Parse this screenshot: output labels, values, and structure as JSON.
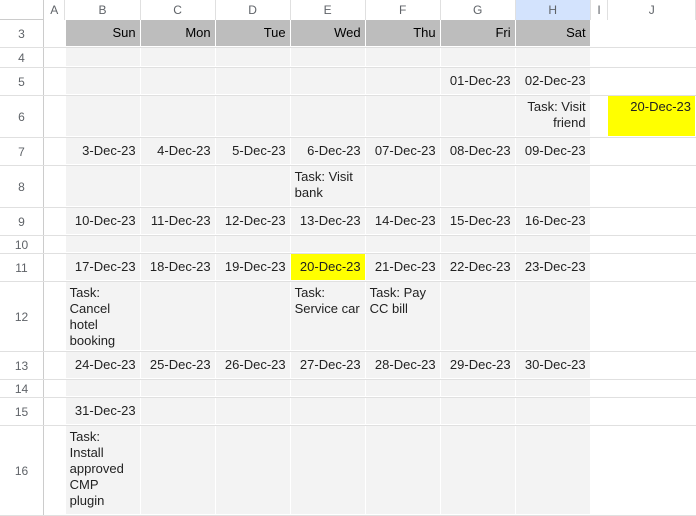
{
  "cols": {
    "A": "A",
    "B": "B",
    "C": "C",
    "D": "D",
    "E": "E",
    "F": "F",
    "G": "G",
    "H": "H",
    "I": "I",
    "J": "J"
  },
  "rows": {
    "3": "3",
    "4": "4",
    "5": "5",
    "6": "6",
    "7": "7",
    "8": "8",
    "9": "9",
    "10": "10",
    "11": "11",
    "12": "12",
    "13": "13",
    "14": "14",
    "15": "15",
    "16": "16"
  },
  "head": {
    "sun": "Sun",
    "mon": "Mon",
    "tue": "Tue",
    "wed": "Wed",
    "thu": "Thu",
    "fri": "Fri",
    "sat": "Sat"
  },
  "d": {
    "g5": "01-Dec-23",
    "h5": "02-Dec-23",
    "h6": "Task: Visit friend",
    "j6": "20-Dec-23",
    "b7": "3-Dec-23",
    "c7": "4-Dec-23",
    "d7": "5-Dec-23",
    "e7": "6-Dec-23",
    "f7": "07-Dec-23",
    "g7": "08-Dec-23",
    "h7": "09-Dec-23",
    "e8": "Task: Visit bank",
    "b9": "10-Dec-23",
    "c9": "11-Dec-23",
    "d9": "12-Dec-23",
    "e9": "13-Dec-23",
    "f9": "14-Dec-23",
    "g9": "15-Dec-23",
    "h9": "16-Dec-23",
    "b11": "17-Dec-23",
    "c11": "18-Dec-23",
    "d11": "19-Dec-23",
    "e11": "20-Dec-23",
    "f11": "21-Dec-23",
    "g11": "22-Dec-23",
    "h11": "23-Dec-23",
    "b12": "Task: Cancel hotel booking",
    "e12": "Task: Service car",
    "f12": "Task: Pay CC bill",
    "b13": "24-Dec-23",
    "c13": "25-Dec-23",
    "d13": "26-Dec-23",
    "e13": "27-Dec-23",
    "f13": "28-Dec-23",
    "g13": "29-Dec-23",
    "h13": "30-Dec-23",
    "b15": "31-Dec-23",
    "b16": "Task: Install approved CMP plugin"
  }
}
